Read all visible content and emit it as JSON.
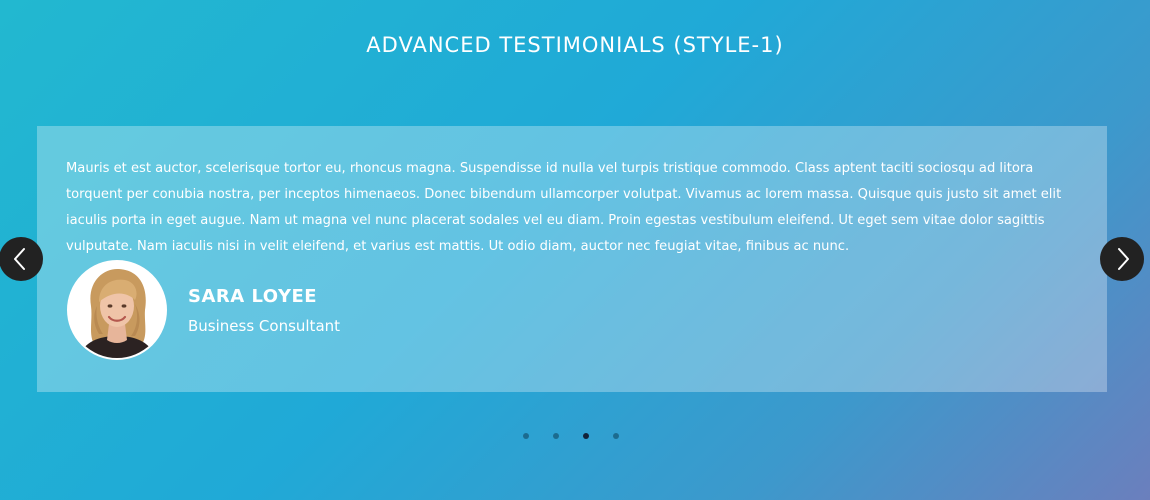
{
  "section": {
    "title": "ADVANCED TESTIMONIALS (STYLE-1)"
  },
  "testimonial": {
    "quote": "Mauris et est auctor, scelerisque tortor eu, rhoncus magna. Suspendisse id nulla vel turpis tristique commodo. Class aptent taciti sociosqu ad litora torquent per conubia nostra, per inceptos himenaeos. Donec bibendum ullamcorper volutpat. Vivamus ac lorem massa. Quisque quis justo sit amet elit iaculis porta in eget augue. Nam ut magna vel nunc placerat sodales vel eu diam. Proin egestas vestibulum eleifend. Ut eget sem vitae dolor sagittis vulputate. Nam iaculis nisi in velit eleifend, et varius est mattis. Ut odio diam, auctor nec feugiat vitae, finibus ac nunc.",
    "name": "SARA LOYEE",
    "role": "Business Consultant"
  },
  "carousel": {
    "prev_icon": "chevron-left-icon",
    "next_icon": "chevron-right-icon",
    "dot_count": 4,
    "active_index": 2
  },
  "colors": {
    "background_start": "#22b8d0",
    "background_end": "#6b7fbd",
    "card_overlay": "rgba(255,255,255,0.30)",
    "nav_button": "#222222",
    "dot": "#1c6b8f",
    "dot_active": "#12223a"
  }
}
